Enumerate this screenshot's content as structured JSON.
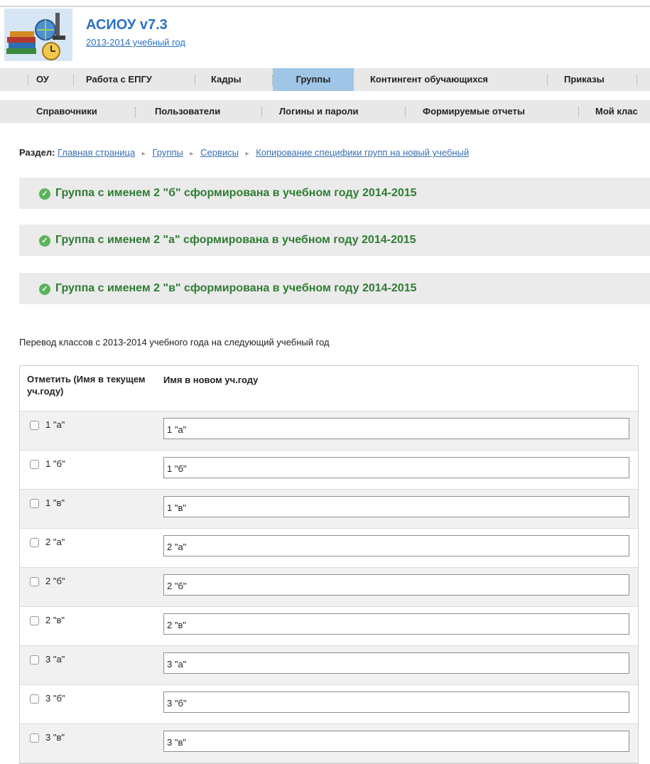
{
  "header": {
    "app_title": "АСИОУ v7.3",
    "school_year": "2013-2014 учебный год",
    "logo_icon": "books-globe-clock-logo"
  },
  "nav": {
    "row1": [
      {
        "label": "ОУ",
        "active": false
      },
      {
        "label": "Работа с ЕПГУ",
        "active": false
      },
      {
        "label": "Кадры",
        "active": false
      },
      {
        "label": "Группы",
        "active": true
      },
      {
        "label": "Контингент обучающихся",
        "active": false
      },
      {
        "label": "Приказы",
        "active": false
      }
    ],
    "row2": [
      {
        "label": "Справочники"
      },
      {
        "label": "Пользователи"
      },
      {
        "label": "Логины и пароли"
      },
      {
        "label": "Формируемые отчеты"
      },
      {
        "label": "Мой клас"
      }
    ],
    "active_color": "#9fc6e6"
  },
  "breadcrumb": {
    "label": "Раздел:",
    "items": [
      "Главная страница",
      "Группы",
      "Сервисы",
      "Копирование специфики групп на новый учебный"
    ]
  },
  "notices": [
    "Группа с именем 2 \"б\" сформирована в учебном году 2014-2015",
    "Группа с именем 2 \"а\" сформирована в учебном году 2014-2015",
    "Группа с именем 2 \"в\" сформирована в учебном году 2014-2015"
  ],
  "intro": "Перевод классов с 2013-2014 учебного года на следующий учебный год",
  "table": {
    "col1": "Отметить (Имя в текущем уч.году)",
    "col2": "Имя в новом уч.году",
    "rows": [
      {
        "current": "1 \"а\"",
        "new": "1 \"а\"",
        "checked": false
      },
      {
        "current": "1 \"б\"",
        "new": "1 \"б\"",
        "checked": false
      },
      {
        "current": "1 \"в\"",
        "new": "1 \"в\"",
        "checked": false
      },
      {
        "current": "2 \"а\"",
        "new": "2 \"а\"",
        "checked": false
      },
      {
        "current": "2 \"б\"",
        "new": "2 \"б\"",
        "checked": false
      },
      {
        "current": "2 \"в\"",
        "new": "2 \"в\"",
        "checked": false
      },
      {
        "current": "3 \"а\"",
        "new": "3 \"а\"",
        "checked": false
      },
      {
        "current": "3 \"б\"",
        "new": "3 \"б\"",
        "checked": false
      },
      {
        "current": "3 \"в\"",
        "new": "3 \"в\"",
        "checked": false
      }
    ]
  },
  "colors": {
    "brand": "#2a71c4",
    "success": "#2e7d32",
    "notice_bg": "#ebebeb"
  }
}
